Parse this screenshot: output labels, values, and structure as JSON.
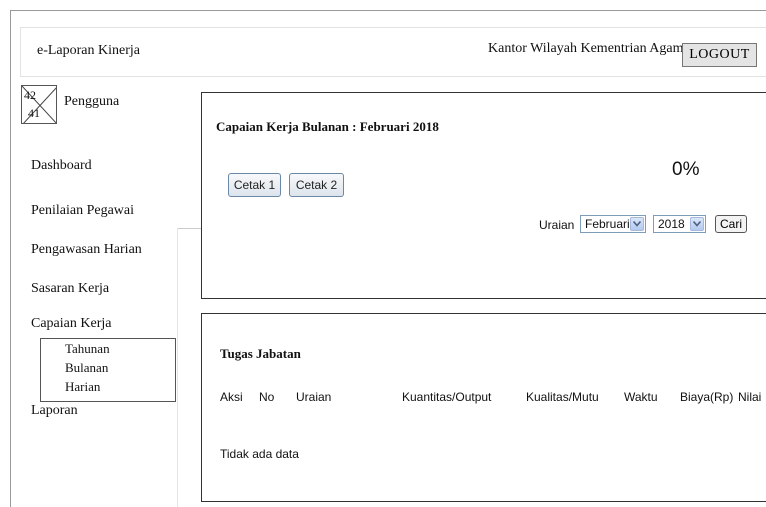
{
  "header": {
    "app_title": "e-Laporan Kinerja",
    "organization": "Kantor Wilayah Kementrian Agama",
    "logout_label": "LOGOUT"
  },
  "user": {
    "avatar_width": "42",
    "avatar_height": "41",
    "label": "Pengguna"
  },
  "sidebar": {
    "items": [
      {
        "label": "Dashboard"
      },
      {
        "label": "Penilaian Pegawai"
      },
      {
        "label": "Pengawasan Harian"
      },
      {
        "label": "Sasaran Kerja"
      },
      {
        "label": "Capaian Kerja"
      },
      {
        "label": "Laporan"
      }
    ],
    "capaian_submenu": [
      {
        "label": "Tahunan"
      },
      {
        "label": "Bulanan"
      },
      {
        "label": "Harian"
      }
    ]
  },
  "summary_panel": {
    "title": "Capaian Kerja Bulanan : Februari  2018",
    "print_buttons": [
      {
        "label": "Cetak 1"
      },
      {
        "label": "Cetak 2"
      }
    ],
    "percent": "0%",
    "filter": {
      "label": "Uraian",
      "month": "Februari",
      "year": "2018",
      "search_label": "Cari"
    }
  },
  "table_panel": {
    "title": "Tugas Jabatan",
    "columns": [
      "Aksi",
      "No",
      "Uraian",
      "Kuantitas/Output",
      "Kualitas/Mutu",
      "Waktu",
      "Biaya(Rp)",
      "Nilai"
    ],
    "empty_message": "Tidak ada data"
  },
  "colors": {
    "button_border": "#6b88a8",
    "select_border": "#7f9db9",
    "select_arrow": "#4d6185"
  },
  "icons": {
    "avatar": "image-placeholder-icon",
    "select_arrow": "chevron-down-icon"
  }
}
